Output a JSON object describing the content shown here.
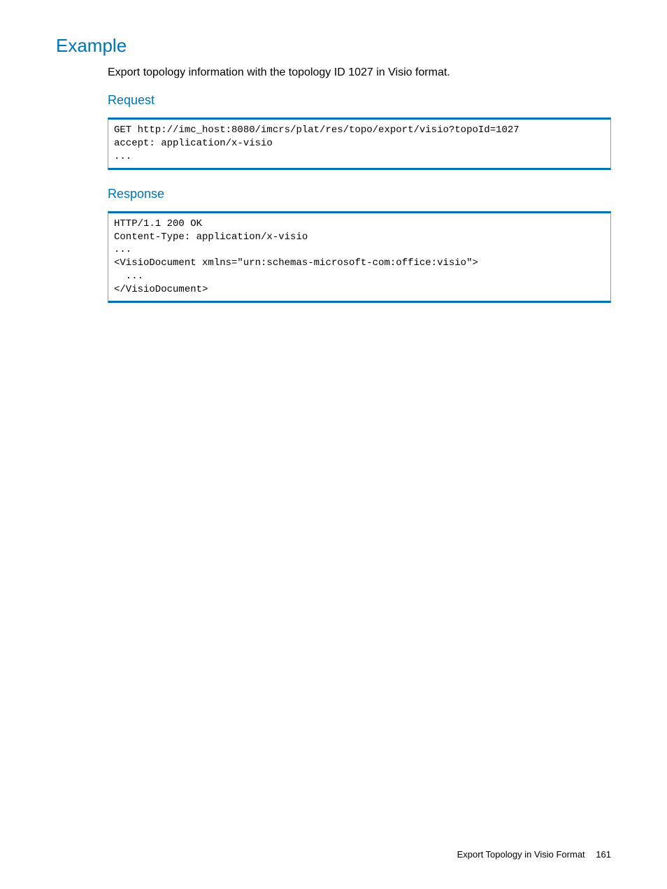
{
  "section": {
    "heading": "Example",
    "description": "Export topology information with the topology ID 1027 in Visio format.",
    "request": {
      "label": "Request",
      "code": "GET http://imc_host:8080/imcrs/plat/res/topo/export/visio?topoId=1027\naccept: application/x-visio\n..."
    },
    "response": {
      "label": "Response",
      "code": "HTTP/1.1 200 OK\nContent-Type: application/x-visio\n...\n<VisioDocument xmlns=\"urn:schemas-microsoft-com:office:visio\">\n  ...\n</VisioDocument>"
    }
  },
  "footer": {
    "title": "Export Topology in Visio Format",
    "page": "161"
  }
}
